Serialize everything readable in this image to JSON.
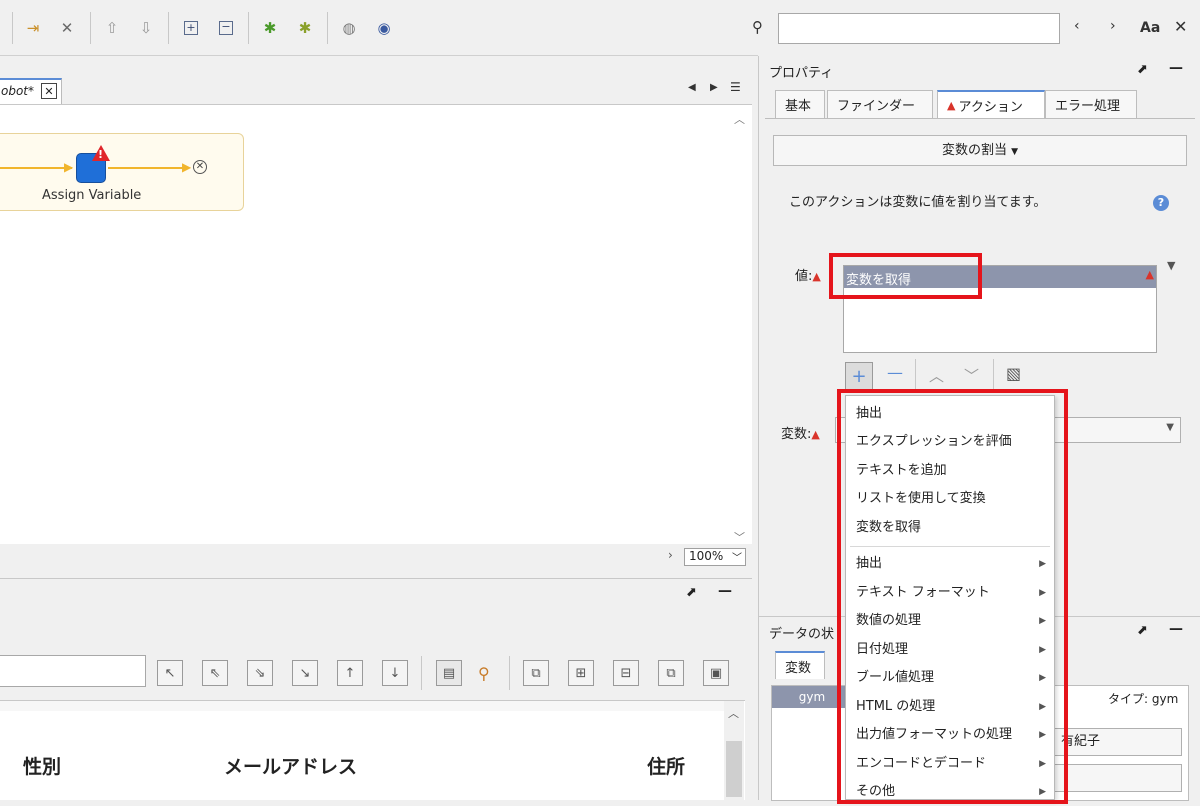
{
  "search": {
    "value": "",
    "placeholder": ""
  },
  "canvas": {
    "tab_label": "obot*",
    "node_label": "Assign Variable",
    "zoom": "100%"
  },
  "properties": {
    "title": "プロパティ",
    "tabs": [
      "基本",
      "ファインダー",
      "アクション",
      "エラー処理"
    ],
    "action_button": "変数の割当",
    "description": "このアクションは変数に値を割り当てます。",
    "value_label": "値:",
    "value_selected": "変数を取得",
    "variable_label": "変数:"
  },
  "menu": {
    "top_items": [
      "抽出",
      "エクスプレッションを評価",
      "テキストを追加",
      "リストを使用して変換",
      "変数を取得"
    ],
    "submenu_items": [
      "抽出",
      "テキスト フォーマット",
      "数値の処理",
      "日付処理",
      "ブール値処理",
      "HTML の処理",
      "出力値フォーマットの処理",
      "エンコードとデコード",
      "その他"
    ]
  },
  "data_state": {
    "title": "データの状",
    "tab": "変数",
    "row_label": "gym",
    "type_label": "タイプ: gym",
    "value_partial": "有紀子"
  },
  "table": {
    "headers": [
      "性別",
      "メールアドレス",
      "住所"
    ]
  },
  "colors": {
    "accent": "#5b8cd6",
    "highlight": "#e5141b",
    "selection": "#8d95ac"
  }
}
